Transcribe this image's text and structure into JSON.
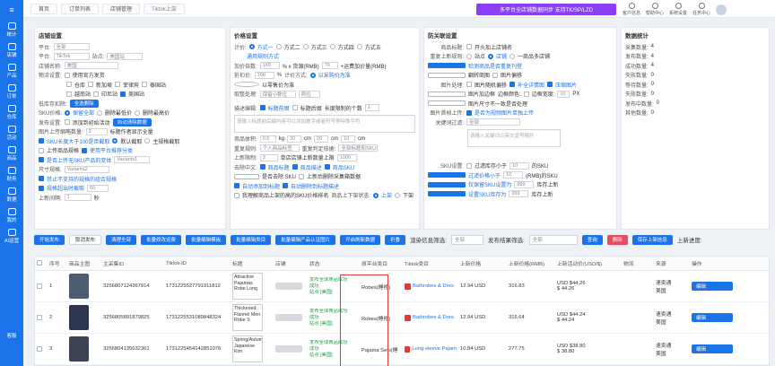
{
  "sidebar": {
    "items": [
      "统计",
      "店铺",
      "产品",
      "订单",
      "仓库",
      "活动",
      "商品",
      "财务",
      "数据",
      "我的",
      "AI运营"
    ],
    "bottom": "客服"
  },
  "tabs": [
    "首页",
    "订单列表",
    "店铺管理",
    "Tiktok上架"
  ],
  "promo": "多平台全店铺数据同步 支持TK/SP/LZD",
  "topicons": [
    "客户信息",
    "帮助中心",
    "系统设置",
    "任务中心"
  ],
  "shop": {
    "title": "店铺设置",
    "platform_label": "平台:",
    "platform_value": "全部",
    "region_label": "平台:",
    "region_value": "TikTok",
    "site_label": "站点:",
    "site_value": "美国站",
    "shopname_label": "店铺名称:",
    "shopname_value": "美国",
    "logistics_label": "物流设置:",
    "logistics_value": "使用官方发货",
    "opts1": [
      "仓库",
      "新加坡",
      "菲律宾",
      "泰国站"
    ],
    "opts2": [
      "越南站",
      "印尼站",
      "美国站"
    ],
    "lowstock_label": "低库存扣除:",
    "lowstock_btn": "全选删除",
    "sku_label": "SKU价格:",
    "sku_value": "保留全部",
    "sku_opts": [
      "删除最低价",
      "删除最高价"
    ],
    "pub_label": "发布设置:",
    "pub_value": "添加到初始活动",
    "pub_btn": "自动清除数据",
    "img_label": "图片上传缩略数量:",
    "img_value": "3",
    "img_hint": "标题作者显示全量",
    "sku100": "SKU长度大于100是否截取",
    "sku100_opt": "默认截取",
    "sku100_opt2": "主规格截取",
    "upload_label": "上传商品规格",
    "upload_opt": "使用平台推荐分类",
    "variant_label": "是否上传无SKU产品的变体",
    "variant_value": "Variants1",
    "size_label": "尺寸规格:",
    "size_value": "Variants2",
    "filter_label": "禁止不支持的规格的组合规格",
    "limit_label": "规格超出时截取",
    "limit_value": "50",
    "time_label": "上新间隔:",
    "time_value": "1",
    "time_unit": "秒"
  },
  "price": {
    "title": "价格设置",
    "plan_label": "计价:",
    "plans": [
      "方式一",
      "方式二",
      "方式三",
      "方式四",
      "方式五"
    ],
    "link": "通用规则方式",
    "mult_label": "加价倍数:",
    "mult_value": "160",
    "mult_mid": "% x 货源(RMB)",
    "mult_add": "76",
    "mult_end": "+运费加价量(RMB)",
    "disc_label": "折扣价:",
    "disc_value": "100",
    "disc_unit": "%",
    "calc_label": "计价方式:",
    "calc_value": "以采购价为准",
    "note": "以零售价为准",
    "round_label": "取整处理:",
    "round_value": "保留小数位",
    "round_mid": "两位",
    "desc_label": "描述编辑:",
    "desc_opts": [
      "标题前缀",
      "标题后缀"
    ],
    "desc_count_label": "长度限制的个数",
    "desc_count": "1",
    "desc_placeholder": "请输入标题前后缀内容可以添加数字或者符号等特殊字符",
    "pkg_label": "商品体积:",
    "pkg_w": "0.5",
    "pkg_w_u": "kg",
    "pkg_l": "30",
    "pkg_h": "20",
    "pkg_d": "10",
    "pkg_u": "cm",
    "dup_label": "重复规则:",
    "dup_value": "个人商品标签",
    "dup_label2": "重复判定依据:",
    "dup_value2": "全部标题和SKU",
    "lim_label": "上新限制:",
    "lim_value": "3",
    "lim_mid": "单店店铺上新数量上限",
    "lim_end": "1000",
    "trans_label": "去除中文:",
    "trans_opts": [
      "商品标题",
      "商品描述",
      "商品SKU"
    ],
    "trans2": "是否去除 SKU",
    "trans3": "上新后删除采集箱数据",
    "auto1": "自动添加到标题",
    "auto2": "自动删除到标题描述",
    "auto3": "我理解商品上架的高的SKU价格排名",
    "ship_label": "商品上下架状态:",
    "ship_opts": [
      "上架",
      "下架"
    ]
  },
  "stock": {
    "title": "防关联设置",
    "wm_label": "商品标题:",
    "wm_value": "开头加上店铺名",
    "wm2_label": "重复上新规则:",
    "wm2_opts": [
      "站点",
      "店铺",
      "一商品多店铺"
    ],
    "opt_a": "检测商品是否重复刊登",
    "opt_b": "翻转商图",
    "opt_c": "图片偏移",
    "img_label": "图片处理:",
    "img_opts": [
      "图片随机偏移",
      "补全详情图",
      "压缩图片"
    ],
    "img_opt2": "图片加边框",
    "border_label": "边框颜色:",
    "border_w": "边框宽度:",
    "border_w_v": "10",
    "border_u": "PX",
    "img_opt3": "图片尺寸不一致是否处理",
    "video_label": "图片首帧上传:",
    "video_value": "是否为视频图片单独上传",
    "kw_label": "关键词过滤:",
    "kw_select": "全部",
    "kw_placeholder": "请输入关键词以英文逗号隔开",
    "sku_label": "SKU设置:",
    "sku_a": "过滤库存小于",
    "sku_a_v": "10",
    "sku_a_u": "的SKU",
    "sku_b": "过滤价格小于",
    "sku_b_v": "10",
    "sku_b_u": "(RMB)的SKU",
    "sku_c": "仅保留SKU设置为",
    "sku_c_v": "999",
    "sku_c_u": "库存上新",
    "sku_d": "设置SKU库存为",
    "sku_d_v": "999",
    "sku_d_u": "库存上新"
  },
  "stats": {
    "title": "数据统计",
    "rows": [
      [
        "采集数量:",
        "4"
      ],
      [
        "发布数量:",
        "4"
      ],
      [
        "成功数量:",
        "4"
      ],
      [
        "失败数量:",
        "0"
      ],
      [
        "等待数量:",
        "0"
      ],
      [
        "失败数量:",
        "0"
      ],
      [
        "发布中数量:",
        "0"
      ],
      [
        "其他数量:",
        "0"
      ]
    ]
  },
  "toolbar": {
    "buttons": [
      "开始发布",
      "取消发布",
      "清理全部",
      "批量修改运费",
      "批量编辑模板",
      "批量编辑类目",
      "批量编辑产品认证图片",
      "开启刷新数据",
      "折叠"
    ],
    "status_label": "渲染信息筛选:",
    "status_value": "全部",
    "pub_label": "发布结果筛选:",
    "pub_value": "全部",
    "search": "查询",
    "delete": "删除",
    "save": "保存上架信息",
    "progress_label": "上新进度:"
  },
  "table": {
    "headers": [
      "",
      "序号",
      "商品主图",
      "主采集ID",
      "Tiktok-ID",
      "标题",
      "店铺",
      "状态",
      "原平台类目",
      "Tiktok类目",
      "上新价格",
      "上新价格(RMB)",
      "上新活动价(USD/$)",
      "物流",
      "来源",
      "操作"
    ],
    "rows": [
      {
        "idx": "1",
        "pid": "3256807124367914",
        "tid": "1731225527791911812",
        "title": "Attractive Pajamas Robe Long",
        "status1": "发布全球商品成功",
        "status2": "成功",
        "status3": "站点 [美国]",
        "cat": "Robes(睡袍)",
        "tt": "Bathrobes & Dres",
        "price": "12.94 USD",
        "rmb": "316.83",
        "act1": "USD $44.26",
        "act2": "$ 44.26",
        "source": "速卖通",
        "source2": "美国",
        "edit": "编辑"
      },
      {
        "idx": "2",
        "pid": "3256805891879825",
        "tid": "1731225531089848324",
        "title": "Thickened Flannel Men Robe S",
        "status1": "发布全球商品成功",
        "status2": "成功",
        "status3": "站点 [美国]",
        "cat": "Robes(睡袍)",
        "tt": "Bathrobes & Dres",
        "price": "12.94 USD",
        "rmb": "316.64",
        "act1": "USD $44.24",
        "act2": "$ 44.24",
        "source": "速卖通",
        "source2": "美国",
        "edit": "编辑"
      },
      {
        "idx": "3",
        "pid": "3256804135632361",
        "tid": "1731225454142851076",
        "title": "Spring/Autumn Japanese Kim",
        "status1": "发布全球商品成功",
        "status2": "成功",
        "status3": "站点 [美国]",
        "cat": "Pajama Sets(睡",
        "tt": "Long-sleeve Pajam",
        "price": "10.84 USD",
        "rmb": "277.75",
        "act1": "USD $38.80",
        "act2": "$ 38.80",
        "source": "速卖通",
        "source2": "美国",
        "edit": "编辑"
      }
    ]
  }
}
